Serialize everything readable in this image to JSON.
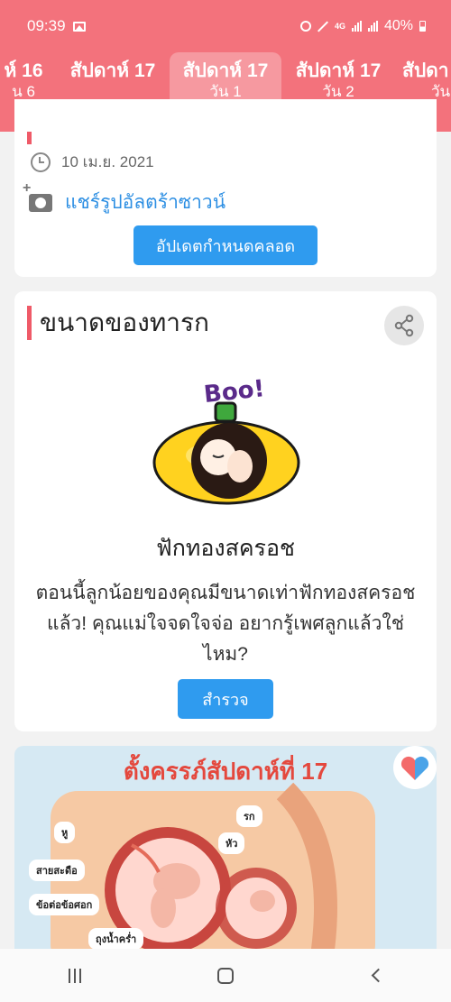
{
  "status_bar": {
    "time": "09:39",
    "network": "4G",
    "battery": "40%"
  },
  "week_tabs": [
    {
      "week": "ห์ 16",
      "day": "น 6",
      "active": false
    },
    {
      "week": "สัปดาห์ 17",
      "day": "",
      "active": false
    },
    {
      "week": "สัปดาห์ 17",
      "day": "วัน 1",
      "active": true
    },
    {
      "week": "สัปดาห์ 17",
      "day": "วัน 2",
      "active": false
    },
    {
      "week": "สัปดา",
      "day": "วัน",
      "active": false
    }
  ],
  "period_card": {
    "date": "10 เม.ย. 2021",
    "share_ultrasound": "แชร์รูปอัลตร้าซาวน์",
    "update_button": "อัปเดตกำหนดคลอด"
  },
  "baby_size_card": {
    "title": "ขนาดของทารก",
    "boo_text": "Boo!",
    "fruit_name": "ฟักทองสครอช",
    "description": "ตอนนี้ลูกน้อยของคุณมีขนาดเท่าฟักทองสครอชแล้ว! คุณแม่ใจจดใจจ่อ อยากรู้เพศลูกแล้วใช่ไหม?",
    "explore_button": "สำรวจ"
  },
  "infographic": {
    "title": "ตั้งครรภ์สัปดาห์ที่ 17",
    "labels": [
      "หู",
      "สายสะดือ",
      "ข้อต่อข้อศอก",
      "ถุงน้ำคร่ำ",
      "รก",
      "หัว"
    ]
  },
  "colors": {
    "header": "#f3727c",
    "accent": "#ef5a68",
    "button": "#2f9bef",
    "link": "#2d8fe3"
  }
}
